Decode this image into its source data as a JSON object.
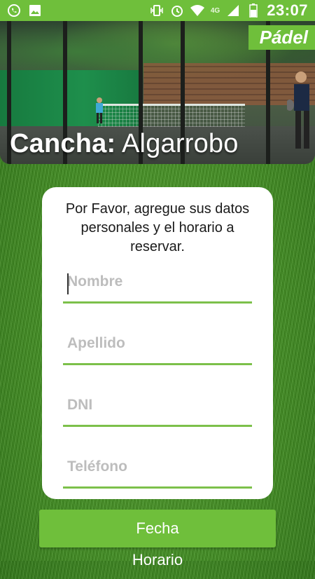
{
  "status_bar": {
    "network_label": "4G",
    "time": "23:07",
    "icons": [
      "whatsapp-icon",
      "image-icon",
      "vibrate-icon",
      "alarm-icon",
      "wifi-icon",
      "signal-icon",
      "battery-icon"
    ]
  },
  "header": {
    "sport": "Pádel",
    "court_prefix": "Cancha:",
    "court_name": "Algarrobo"
  },
  "form": {
    "intro": "Por Favor, agregue sus datos personales y el horario a reservar.",
    "fields": [
      {
        "placeholder": "Nombre",
        "value": ""
      },
      {
        "placeholder": "Apellido",
        "value": ""
      },
      {
        "placeholder": "DNI",
        "value": ""
      },
      {
        "placeholder": "Teléfono",
        "value": ""
      }
    ]
  },
  "buttons": {
    "date": "Fecha",
    "time": "Horario"
  },
  "colors": {
    "accent": "#6fbf3b",
    "underline": "#7cc04a"
  }
}
